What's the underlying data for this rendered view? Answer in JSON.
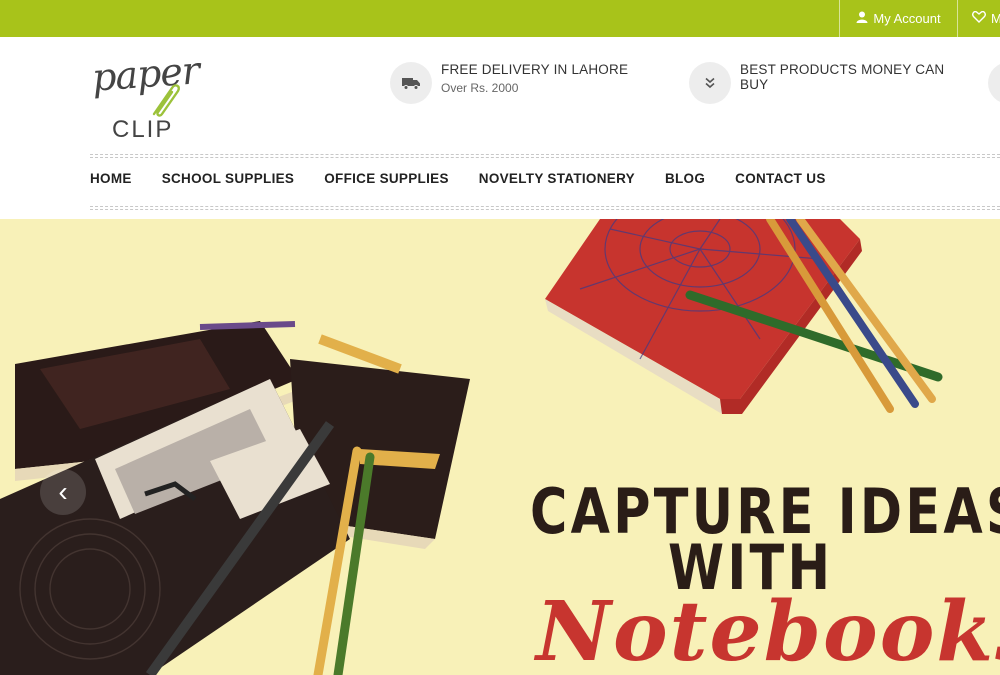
{
  "topbar": {
    "account_label": "My Account",
    "wishlist_label": "M"
  },
  "logo": {
    "top_text": "paper",
    "bottom_text": "CLIP"
  },
  "features": [
    {
      "title": "FREE DELIVERY IN LAHORE",
      "subtitle": "Over Rs. 2000",
      "icon": "truck-icon"
    },
    {
      "title": "BEST PRODUCTS MONEY CAN BUY",
      "subtitle": "",
      "icon": "chevrons-down-icon"
    }
  ],
  "nav": [
    {
      "label": "HOME"
    },
    {
      "label": "SCHOOL SUPPLIES"
    },
    {
      "label": "OFFICE SUPPLIES"
    },
    {
      "label": "NOVELTY STATIONERY"
    },
    {
      "label": "BLOG"
    },
    {
      "label": "CONTACT US"
    }
  ],
  "hero": {
    "line1": "CAPTURE IDEAS",
    "line2": "WITH",
    "line3": "Notebooks",
    "prev_arrow": "‹"
  },
  "colors": {
    "topbar": "#a8c31a",
    "hero_bg": "#f8f1b8",
    "headline": "#2a1d17",
    "script": "#c7352f"
  }
}
